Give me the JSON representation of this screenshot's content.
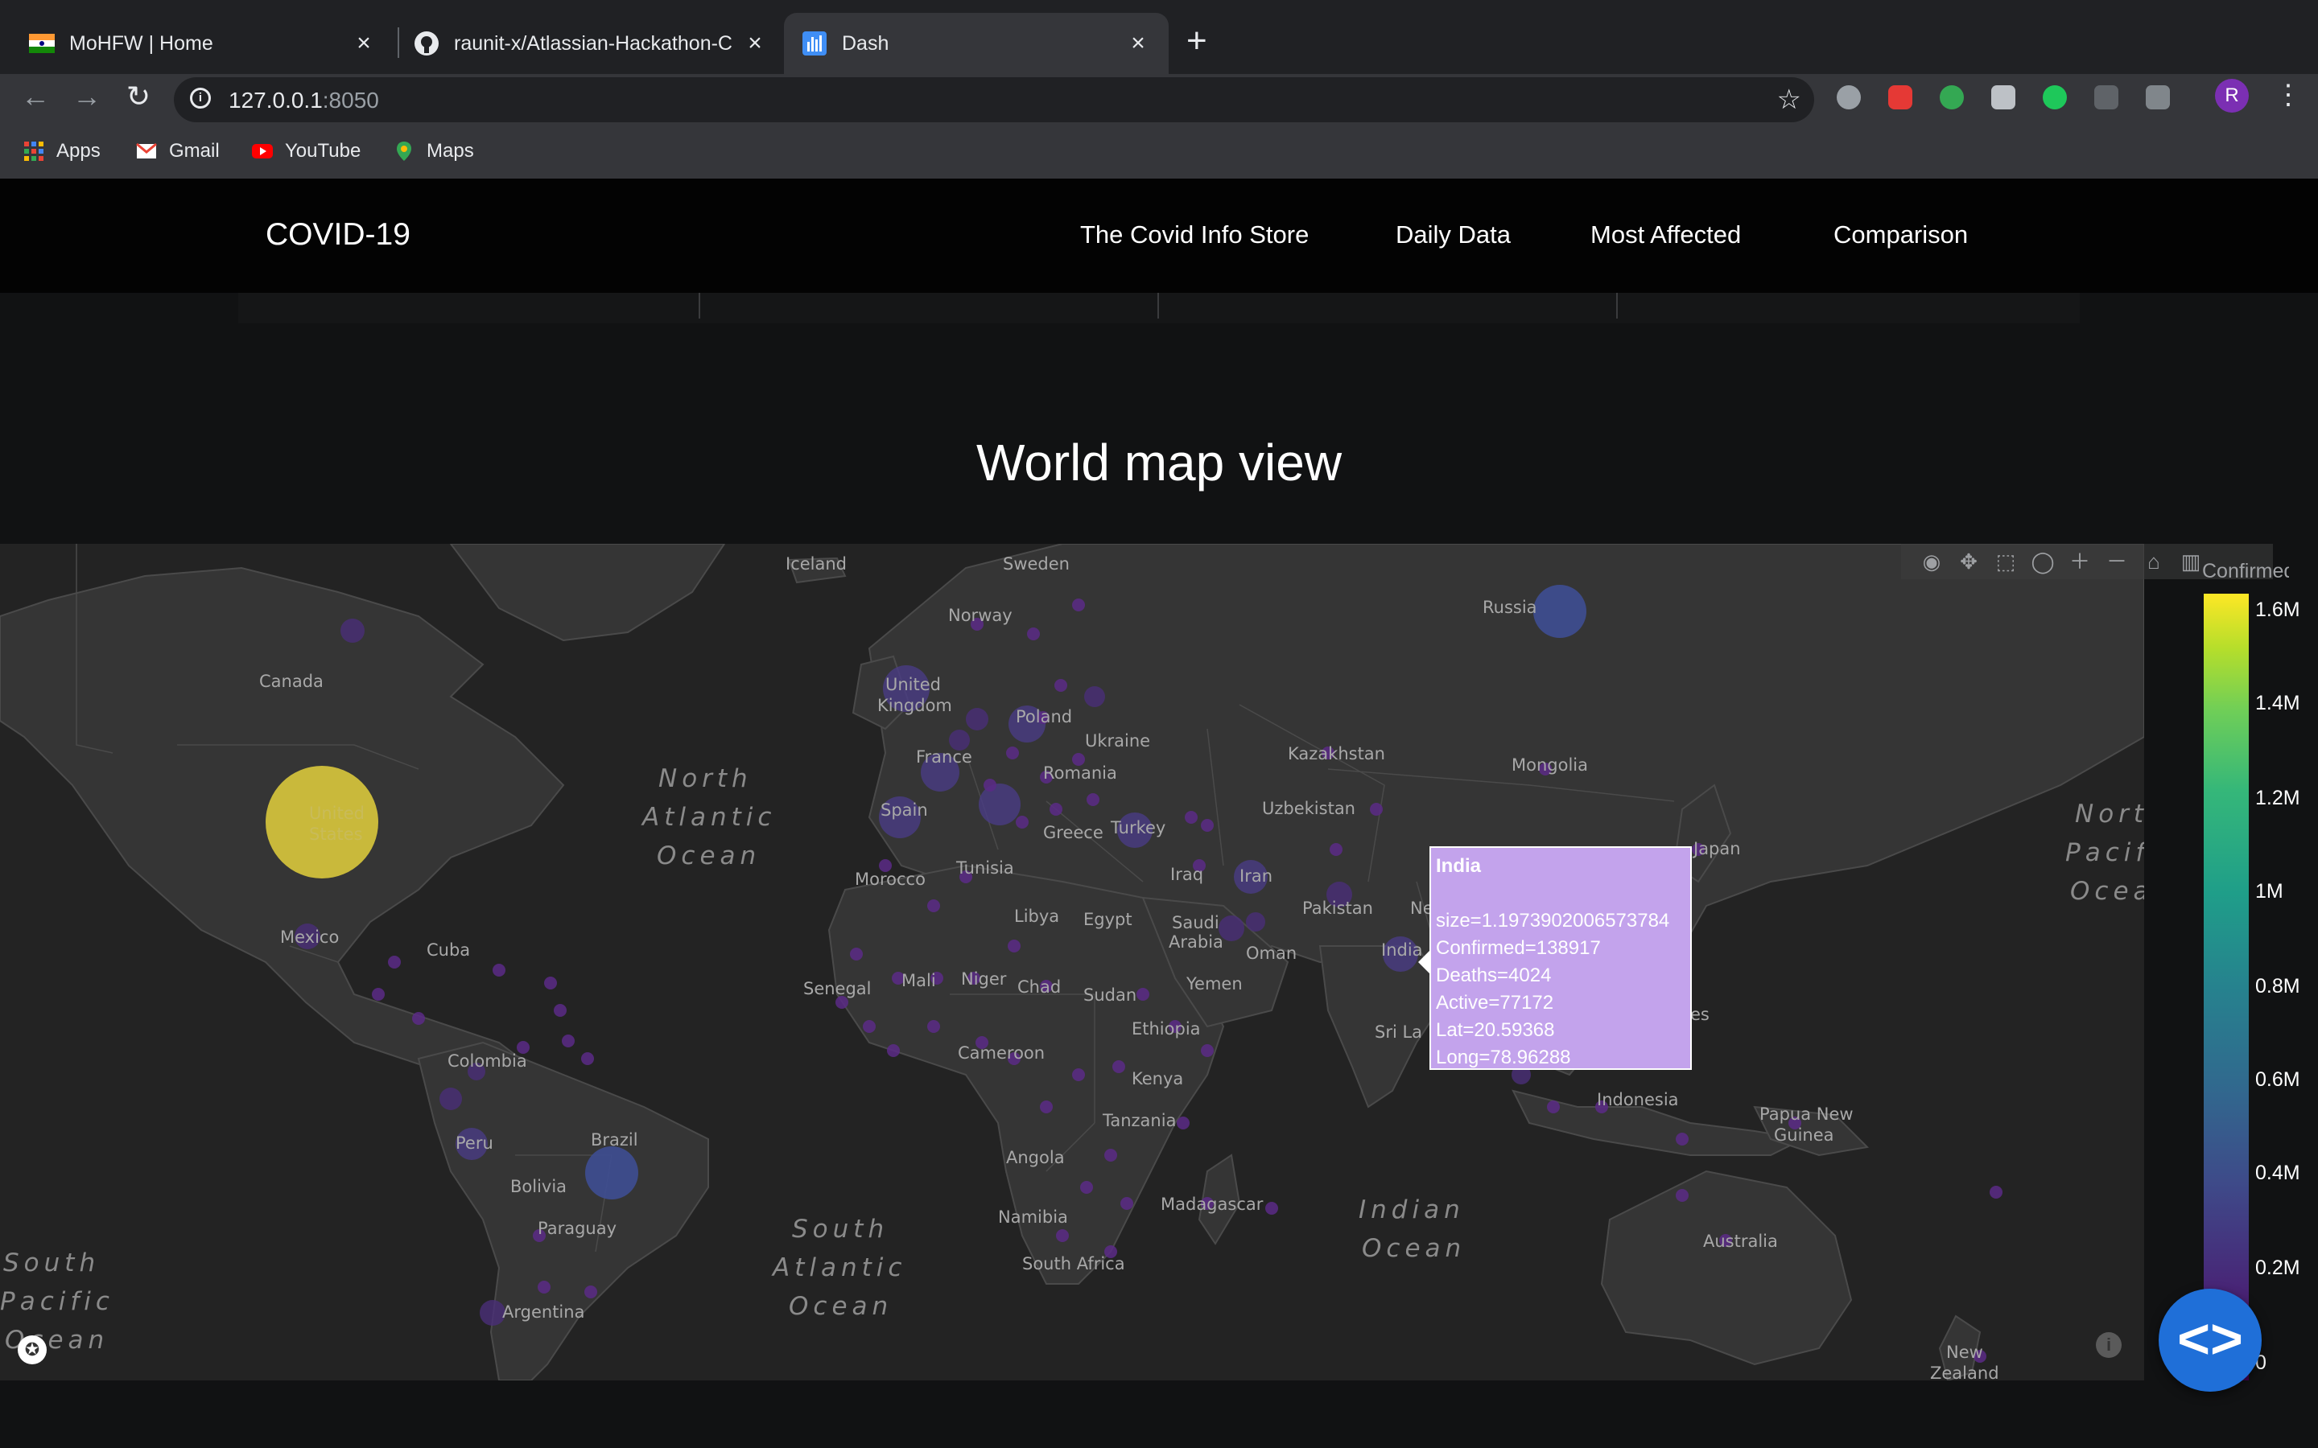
{
  "browser": {
    "tabs": [
      {
        "title": "MoHFW | Home",
        "icon": "india-flag-icon"
      },
      {
        "title": "raunit-x/Atlassian-Hackathon-C",
        "icon": "github-icon"
      },
      {
        "title": "Dash",
        "icon": "plotly-dash-icon"
      }
    ],
    "url_host": "127.0.0.1",
    "url_port": ":8050",
    "profile_initial": "R",
    "bookmarks": [
      "Apps",
      "Gmail",
      "YouTube",
      "Maps"
    ]
  },
  "site": {
    "brand": "COVID-19",
    "nav": [
      "The Covid Info Store",
      "Daily Data",
      "Most Affected",
      "Comparison"
    ]
  },
  "heading": "World map view",
  "map": {
    "colorbar_title": "Confirmed",
    "colorbar_ticks": [
      "1.6M",
      "1.4M",
      "1.2M",
      "1M",
      "0.8M",
      "0.6M",
      "0.4M",
      "0.2M",
      "0"
    ],
    "labels": {
      "iceland": "Iceland",
      "sweden": "Sweden",
      "norway": "Norway",
      "russia": "Russia",
      "canada": "Canada",
      "united_kingdom_1": "United",
      "united_kingdom_2": "Kingdom",
      "poland": "Poland",
      "ukraine": "Ukraine",
      "kazakhstan": "Kazakhstan",
      "mongolia": "Mongolia",
      "united_states_1": "United",
      "united_states_2": "States",
      "france": "France",
      "romania": "Romania",
      "uzbekistan": "Uzbekistan",
      "spain": "Spain",
      "greece": "Greece",
      "turkey": "Turkey",
      "japan": "Japan",
      "tunisia": "Tunisia",
      "morocco": "Morocco",
      "iraq": "Iraq",
      "iran": "Iran",
      "libya": "Libya",
      "egypt": "Egypt",
      "pakistan": "Pakistan",
      "saudi_1": "Saudi",
      "saudi_2": "Arabia",
      "mexico": "Mexico",
      "cuba": "Cuba",
      "oman": "Oman",
      "india": "India",
      "mali": "Mali",
      "niger": "Niger",
      "chad": "Chad",
      "senegal": "Senegal",
      "sudan": "Sudan",
      "yemen": "Yemen",
      "ethiopia": "Ethiopia",
      "sri_lanka": "Sri La",
      "colombia": "Colombia",
      "cameroon": "Cameroon",
      "indonesia": "Indonesia",
      "kenya": "Kenya",
      "papua_1": "Papua New",
      "papua_2": "Guinea",
      "tanzania": "Tanzania",
      "brazil": "Brazil",
      "angola": "Angola",
      "peru": "Peru",
      "bolivia": "Bolivia",
      "madagascar": "Madagascar",
      "namibia": "Namibia",
      "paraguay": "Paraguay",
      "australia": "Australia",
      "south_africa": "South Africa",
      "argentina": "Argentina",
      "new_zealand_1": "New",
      "new_zealand_2": "Zealand",
      "ne": "Ne",
      "es": "es",
      "north_atlantic_1": "North",
      "north_atlantic_2": "Atlantic",
      "north_atlantic_3": "Ocean",
      "south_atlantic_1": "South",
      "south_atlantic_2": "Atlantic",
      "south_atlantic_3": "Ocean",
      "indian_ocean_1": "Indian",
      "indian_ocean_2": "Ocean",
      "north_pacific_1": "Nort",
      "north_pacific_2": "Pacif",
      "north_pacific_3": "Ocea",
      "south_pacific_1": "South",
      "south_pacific_2": "Pacific",
      "south_pacific_3": "Ocean"
    }
  },
  "tooltip": {
    "country": "India",
    "size": "size=1.1973902006573784",
    "confirmed": "Confirmed=138917",
    "deaths": "Deaths=4024",
    "active": "Active=77172",
    "lat": "Lat=20.59368",
    "long": "Long=78.96288"
  },
  "colors": {
    "page_bg": "#111213",
    "navbar_bg": "#030303",
    "map_land": "#353535",
    "map_water": "#232323",
    "tooltip_bg": "#c3a3ec",
    "us_bubble": "#d9c83c",
    "fab_blue": "#1f6fd8"
  },
  "icons": {
    "fab": "code-brackets-icon",
    "modebar": [
      "camera-icon",
      "pan-icon",
      "box-select-icon",
      "lasso-icon",
      "zoom-in-icon",
      "zoom-out-icon",
      "home-icon",
      "plotly-logo-icon"
    ]
  }
}
